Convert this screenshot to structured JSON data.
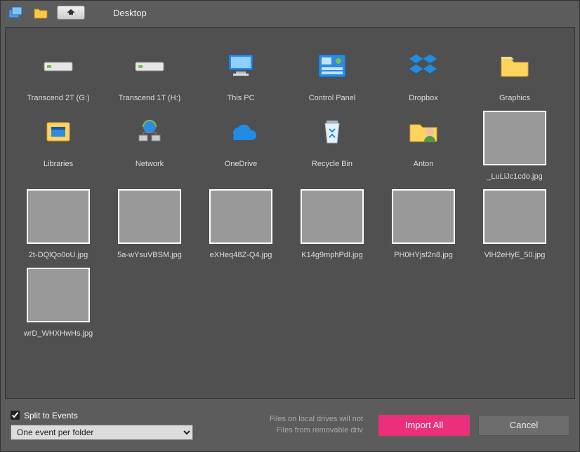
{
  "toolbar": {
    "location": "Desktop"
  },
  "items": [
    {
      "kind": "drive",
      "label": "Transcend 2T (G:)"
    },
    {
      "kind": "drive",
      "label": "Transcend 1T (H:)"
    },
    {
      "kind": "pc",
      "label": "This PC"
    },
    {
      "kind": "cpl",
      "label": "Control Panel"
    },
    {
      "kind": "dropbox",
      "label": "Dropbox"
    },
    {
      "kind": "folder",
      "label": "Graphics"
    },
    {
      "kind": "libraries",
      "label": "Libraries"
    },
    {
      "kind": "network",
      "label": "Network"
    },
    {
      "kind": "onedrive",
      "label": "OneDrive"
    },
    {
      "kind": "recycle",
      "label": "Recycle Bin"
    },
    {
      "kind": "user",
      "label": "Anton"
    },
    {
      "kind": "image",
      "label": "_LuLiJc1cdo.jpg",
      "cls": "ls8"
    },
    {
      "kind": "image",
      "label": "2t-DQlQo0oU.jpg",
      "cls": "ls1"
    },
    {
      "kind": "image",
      "label": "5a-wYsuVBSM.jpg",
      "cls": "ls2"
    },
    {
      "kind": "image",
      "label": "eXHeq48Z-Q4.jpg",
      "cls": "ls3"
    },
    {
      "kind": "image",
      "label": "K14g9mphPdI.jpg",
      "cls": "ls4"
    },
    {
      "kind": "image",
      "label": "PH0HYjsf2n8.jpg",
      "cls": "ls5"
    },
    {
      "kind": "image",
      "label": "VlH2eHyE_50.jpg",
      "cls": "ls6"
    },
    {
      "kind": "image",
      "label": "wrD_WHXHwHs.jpg",
      "cls": "ls7"
    }
  ],
  "footer": {
    "split_label": "Split to Events",
    "split_checked": true,
    "select_value": "One event per folder",
    "note_line1": "Files on local drives will not",
    "note_line2": "Files from removable driv",
    "import_btn": "Import All",
    "cancel_btn": "Cancel"
  }
}
